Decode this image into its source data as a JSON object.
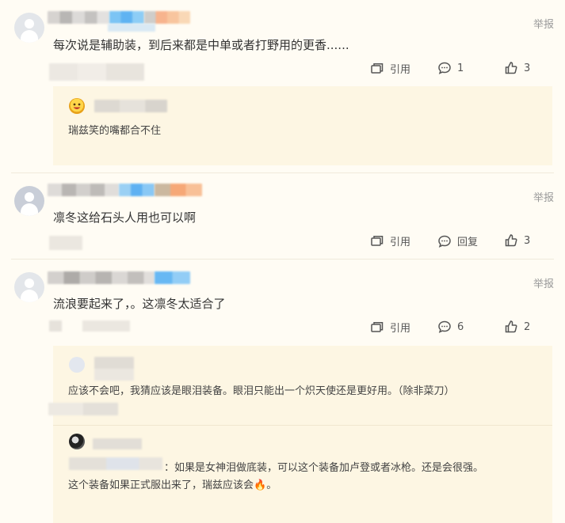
{
  "comments": [
    {
      "report": "举报",
      "text": "每次说是辅助装，到后来都是中单或者打野用的更香......",
      "actions": {
        "quote": "引用",
        "reply": "1",
        "like": "3"
      },
      "reply": {
        "text": "瑞兹笑的嘴都合不住"
      }
    },
    {
      "report": "举报",
      "text": "凛冬这给石头人用也可以啊",
      "actions": {
        "quote": "引用",
        "reply": "回复",
        "like": "3"
      }
    },
    {
      "report": "举报",
      "text": "流浪要起来了，。这凛冬太适合了",
      "actions": {
        "quote": "引用",
        "reply": "6",
        "like": "2"
      },
      "replies": [
        {
          "text": "应该不会吧，我猜应该是眼泪装备。眼泪只能出一个炽天使还是更好用。（除非菜刀）"
        },
        {
          "text_line1": "：如果是女神泪做底装，可以这个装备加卢登或者冰枪。还是会很强。",
          "text_line2": "这个装备如果正式服出来了，瑞兹应该会",
          "text_line2_end": "。",
          "emoji": "🔥"
        }
      ]
    }
  ],
  "icons": [
    "avatar-icon",
    "quote-icon",
    "comment-icon",
    "thumbs-up-icon",
    "fire-emoji"
  ]
}
